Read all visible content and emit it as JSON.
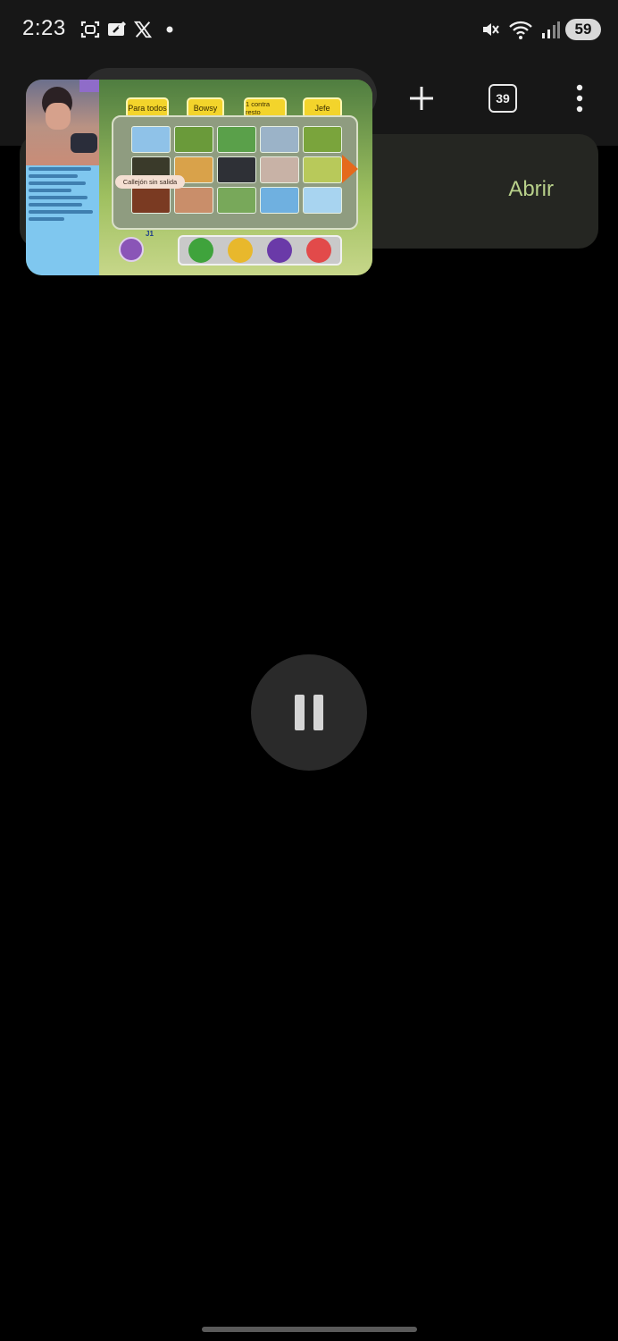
{
  "status_bar": {
    "time": "2:23",
    "notification_icons": [
      "screenshot-icon",
      "cast-icon",
      "x-logo-icon",
      "dot-icon"
    ],
    "system_icons": [
      "mute-icon",
      "wifi-icon",
      "signal-icon"
    ],
    "battery": "59"
  },
  "toolbar": {
    "tab_count": "39"
  },
  "banner": {
    "open_label": "Abrir"
  },
  "pip_video": {
    "game_tabs": [
      "Para todos",
      "Bowsy",
      "1 contra resto",
      "Jefe"
    ],
    "tooltip": "Callejón sin salida",
    "player_label": "J1"
  },
  "colors": {
    "background": "#000000",
    "toolbar": "#171717",
    "accent": "#b8d08a",
    "pause_button": "#2a2a2a"
  }
}
